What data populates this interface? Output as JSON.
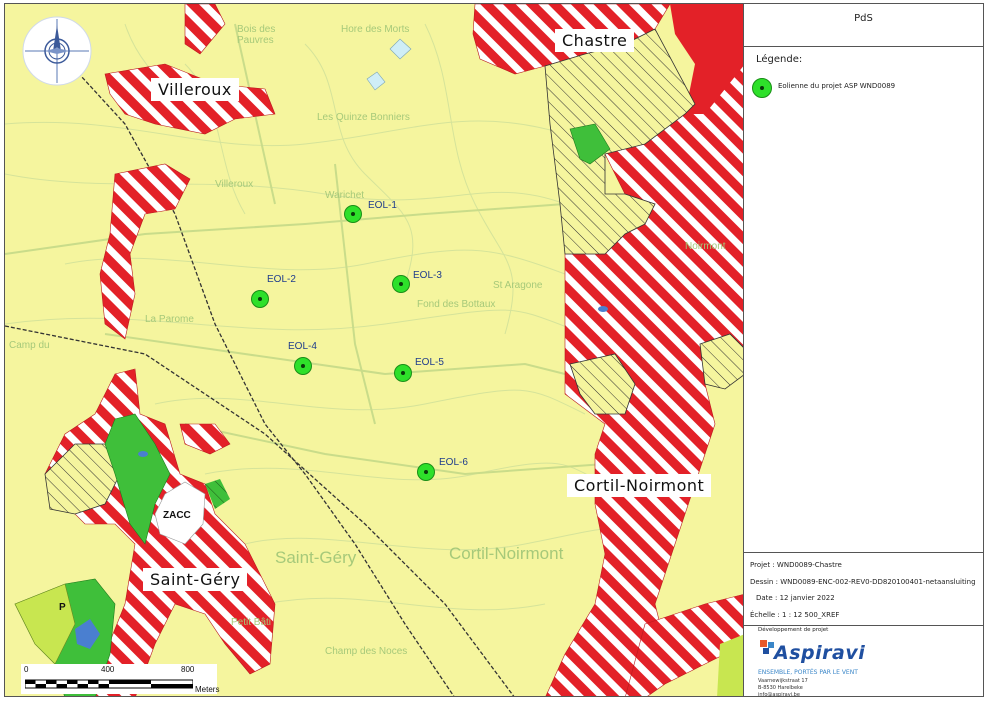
{
  "panel": {
    "title": "PdS",
    "legend_title": "Légende:",
    "legend_item": "Eolienne du projet ASP WND0089",
    "info": {
      "project_key": "Projet :",
      "project_val": "WND0089-Chastre",
      "drawing_key": "Dessin :",
      "drawing_val": "WND0089-ENC-002-REV0-DD820100401-netaansluiting",
      "date_key": "Date :",
      "date_val": "12 janvier 2022",
      "scale_key": "Échelle :",
      "scale_val": "1 : 12 500_XREF"
    },
    "developer_label": "Développement de projet",
    "logo_text": "Aspiravi",
    "logo_tagline": "ENSEMBLE, PORTÉS PAR LE VENT",
    "address": [
      "Vaarnewijkstraat 17",
      "B-8530 Harelbeke",
      "info@aspiravi.be"
    ]
  },
  "places": {
    "villeroux": "Villeroux",
    "chastre": "Chastre",
    "cortil": "Cortil-Noirmont",
    "saint_gery": "Saint-Géry",
    "zacc": "ZACC",
    "p": "P"
  },
  "map_texts": {
    "bois_des_pauvres": "Bois des\nPauvres",
    "hore_des_morts": "Hore des Morts",
    "quinze_bonniers": "Les Quinze Bonniers",
    "villeroux_small": "Villeroux",
    "warichet": "Warichet",
    "fond_des_bottaux": "Fond des Bottaux",
    "st_aragone": "St Aragone",
    "la_parome": "La Parome",
    "camp_du": "Camp du",
    "saint_gery_map": "Saint-Géry",
    "cortil_map": "Cortil-Noirmont",
    "petit_bati": "Petit Bâti",
    "champ_des_noces": "Champ des Noces",
    "noirmont": "Noirmont"
  },
  "turbines": [
    {
      "id": "EOL-1"
    },
    {
      "id": "EOL-2"
    },
    {
      "id": "EOL-3"
    },
    {
      "id": "EOL-4"
    },
    {
      "id": "EOL-5"
    },
    {
      "id": "EOL-6"
    }
  ],
  "scalebar": {
    "labels": [
      "0",
      "400",
      "800"
    ],
    "unit": "Meters"
  },
  "colors": {
    "base": "#f5f59e",
    "habitat_red": "#e32128",
    "turbine": "#2ee02a",
    "green_zone": "#3fbf3a",
    "lime_zone": "#c8e650",
    "logo_blue": "#1f4fa0"
  }
}
